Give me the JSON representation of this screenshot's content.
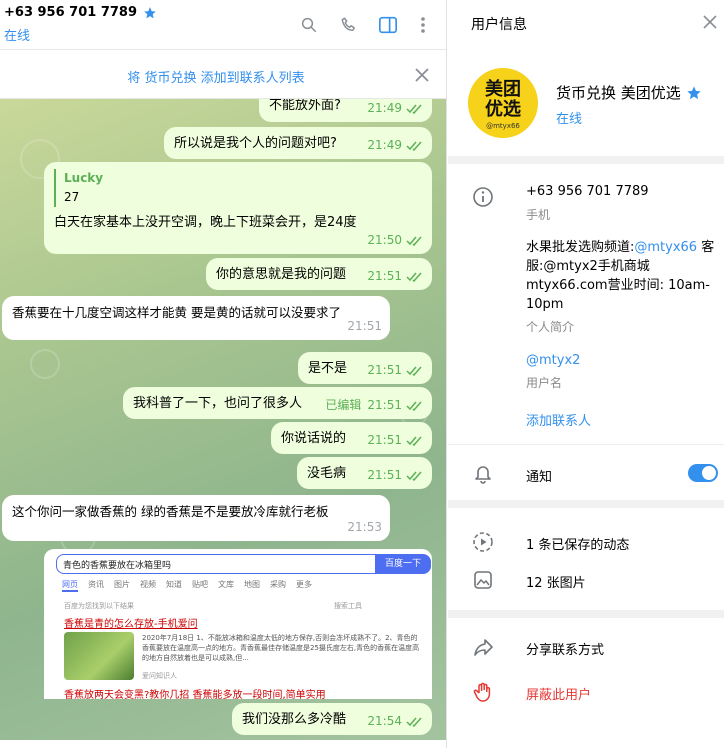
{
  "chat": {
    "title": "+63 956 701 7789",
    "status": "在线",
    "banner": "将 货币兑换 添加到联系人列表",
    "messages": [
      {
        "text": "不能放外面?",
        "time": "21:49"
      },
      {
        "text": "所以说是我个人的问题对吧?",
        "time": "21:49"
      },
      {
        "quote_name": "Lucky",
        "quote_text": "27",
        "text": "白天在家基本上没开空调，晚上下班菜会开，是24度",
        "time": "21:50"
      },
      {
        "text": "你的意思就是我的问题",
        "time": "21:51"
      },
      {
        "text": "香蕉要在十几度空调这样才能黄   要是黄的话就可以没要求了",
        "time": "21:51"
      },
      {
        "text": "是不是",
        "time": "21:51"
      },
      {
        "text": "我科普了一下，也问了很多人",
        "edited": "已编辑",
        "time": "21:51"
      },
      {
        "text": "你说话说的",
        "time": "21:51"
      },
      {
        "text": "没毛病",
        "time": "21:51"
      },
      {
        "text": "这个你问一家做香蕉的   绿的香蕉是不是要放冷库就行老板",
        "time": "21:53"
      },
      {
        "text": "我们没那么多冷酷",
        "time": "21:54"
      }
    ],
    "screenshot": {
      "query": "青色的香蕉要放在冰箱里吗",
      "button": "百度一下",
      "tabs": [
        "网页",
        "资讯",
        "图片",
        "视频",
        "知道",
        "贴吧",
        "文库",
        "地图",
        "采购",
        "更多"
      ],
      "hint": "百度为您找到以下结果",
      "tools": "搜索工具",
      "result_title": "香蕉是青的怎么存放-手机爱问",
      "result_desc": "2020年7月18日 1、不能放冰箱和温度太低的地方保存,否则会冻坏成熟不了。2、青色的香蕉要放在温度高一点的地方。青香蕉最佳存储温度是25摄氏度左右,青色的香蕉在温度高的地方自然放着也是可以成熟,但...",
      "result_source": "爱问知识人",
      "result2_title": "香蕉放两天会变黑?教你几招 香蕉能多放一段时间,简单实用"
    }
  },
  "info": {
    "title": "用户信息",
    "logo_line1": "美团",
    "logo_line2": "优选",
    "logo_handle": "@mtyx66",
    "name": "货币兑换 美团优选",
    "status": "在线",
    "phone": "+63 956 701 7789",
    "phone_label": "手机",
    "bio_prefix": "水果批发选购频道:",
    "bio_mention": "@mtyx66",
    "bio_rest": " 客服:@mtyx2手机商城mtyx66.com营业时间: 10am-10pm",
    "bio_label": "个人简介",
    "username": "@mtyx2",
    "username_label": "用户名",
    "add_contact": "添加联系人",
    "notifications": "通知",
    "notifications_on": true,
    "saved_stories": "1 条已保存的动态",
    "photos": "12 张图片",
    "share_contact": "分享联系方式",
    "block_user": "屏蔽此用户"
  },
  "colors": {
    "accent": "#3390ec",
    "outgoing_bubble": "#effedd",
    "check_green": "#5cb157",
    "danger": "#e53935"
  }
}
